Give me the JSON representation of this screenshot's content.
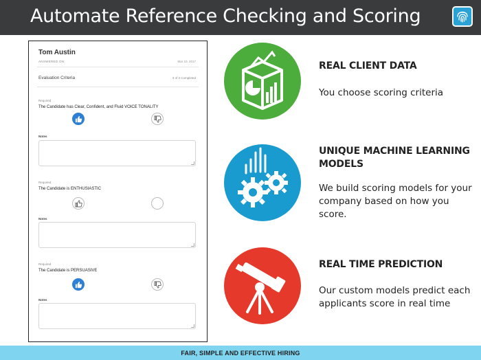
{
  "header": {
    "title": "Automate Reference Checking and Scoring",
    "logo_icon": "fingerprint-icon",
    "background": "#3a3b3c"
  },
  "form": {
    "name": "Tom Austin",
    "answered_label": "ANSWERED ON:",
    "date": "Mar 10, 2017",
    "criteria_label": "Evaluation Criteria",
    "completed": "3 of 3 Completed",
    "questions": [
      {
        "required": "Required",
        "text": "The Candidate has Clear, Confident, and Fluid VOICE TONALITY",
        "selected": "up",
        "notes_label": "Notes"
      },
      {
        "required": "Required",
        "text": "The Candidate is ENTHUSIASTIC",
        "selected": "down",
        "notes_label": "Notes"
      },
      {
        "required": "Required",
        "text": "The Candidate is PERSUASIVE",
        "selected": "up",
        "notes_label": "Notes"
      }
    ]
  },
  "features": [
    {
      "heading": "REAL CLIENT DATA",
      "body": "You choose scoring criteria",
      "icon": "analytics-charts-icon",
      "color": "#4cac3c"
    },
    {
      "heading": "UNIQUE MACHINE LEARNING MODELS",
      "body": "We build scoring models for your company based on how you score.",
      "icon": "gears-icon",
      "color": "#1a9bd0"
    },
    {
      "heading": "REAL TIME PREDICTION",
      "body": "Our custom models predict each applicants score in real time",
      "icon": "telescope-icon",
      "color": "#e4392b"
    }
  ],
  "footer": {
    "text": "FAIR, SIMPLE AND EFFECTIVE HIRING",
    "background": "#7fd4f0"
  }
}
